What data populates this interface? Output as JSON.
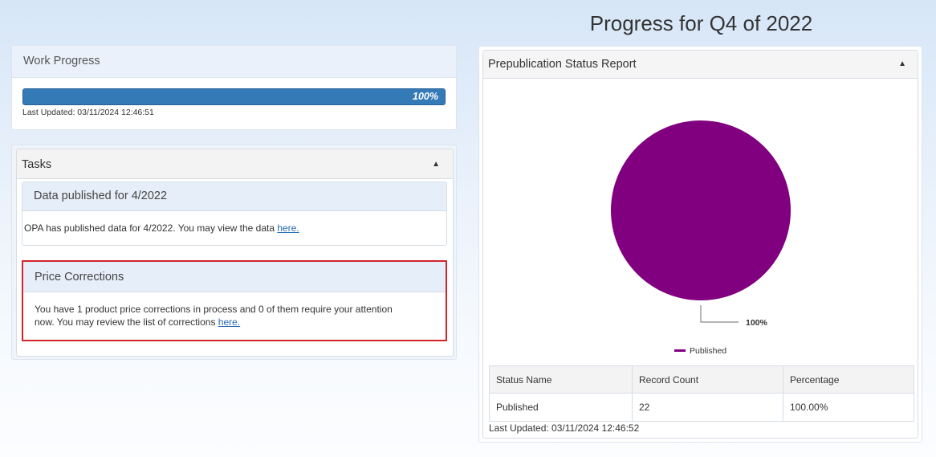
{
  "page_title": "Progress for Q4 of 2022",
  "work_progress": {
    "title": "Work Progress",
    "progress": 1.0,
    "progress_label": "100%",
    "last_updated": "Last Updated: 03/11/2024 12:46:51"
  },
  "tasks": {
    "title": "Tasks",
    "collapse_glyph": "▲",
    "items": [
      {
        "title": "Data published for 4/2022",
        "text": "OPA has published data for 4/2022. You may view the data ",
        "link_text": "here."
      },
      {
        "title": "Price Corrections",
        "text": "You have 1 product price corrections in process and 0 of them require your attention now. You may review the list of corrections ",
        "link_text": "here."
      }
    ]
  },
  "status_report": {
    "title": "Prepublication Status Report",
    "collapse_glyph": "▲",
    "table": {
      "headers": [
        "Status Name",
        "Record Count",
        "Percentage"
      ],
      "rows": [
        [
          "Published",
          "22",
          "100.00%"
        ]
      ]
    },
    "last_updated": "Last Updated: 03/11/2024 12:46:52"
  },
  "chart_data": {
    "type": "pie",
    "slices": [
      {
        "name": "Published",
        "value": 100,
        "label": "100%",
        "color": "#800080"
      }
    ],
    "legend": [
      "Published"
    ],
    "legend_position": "bottom"
  }
}
